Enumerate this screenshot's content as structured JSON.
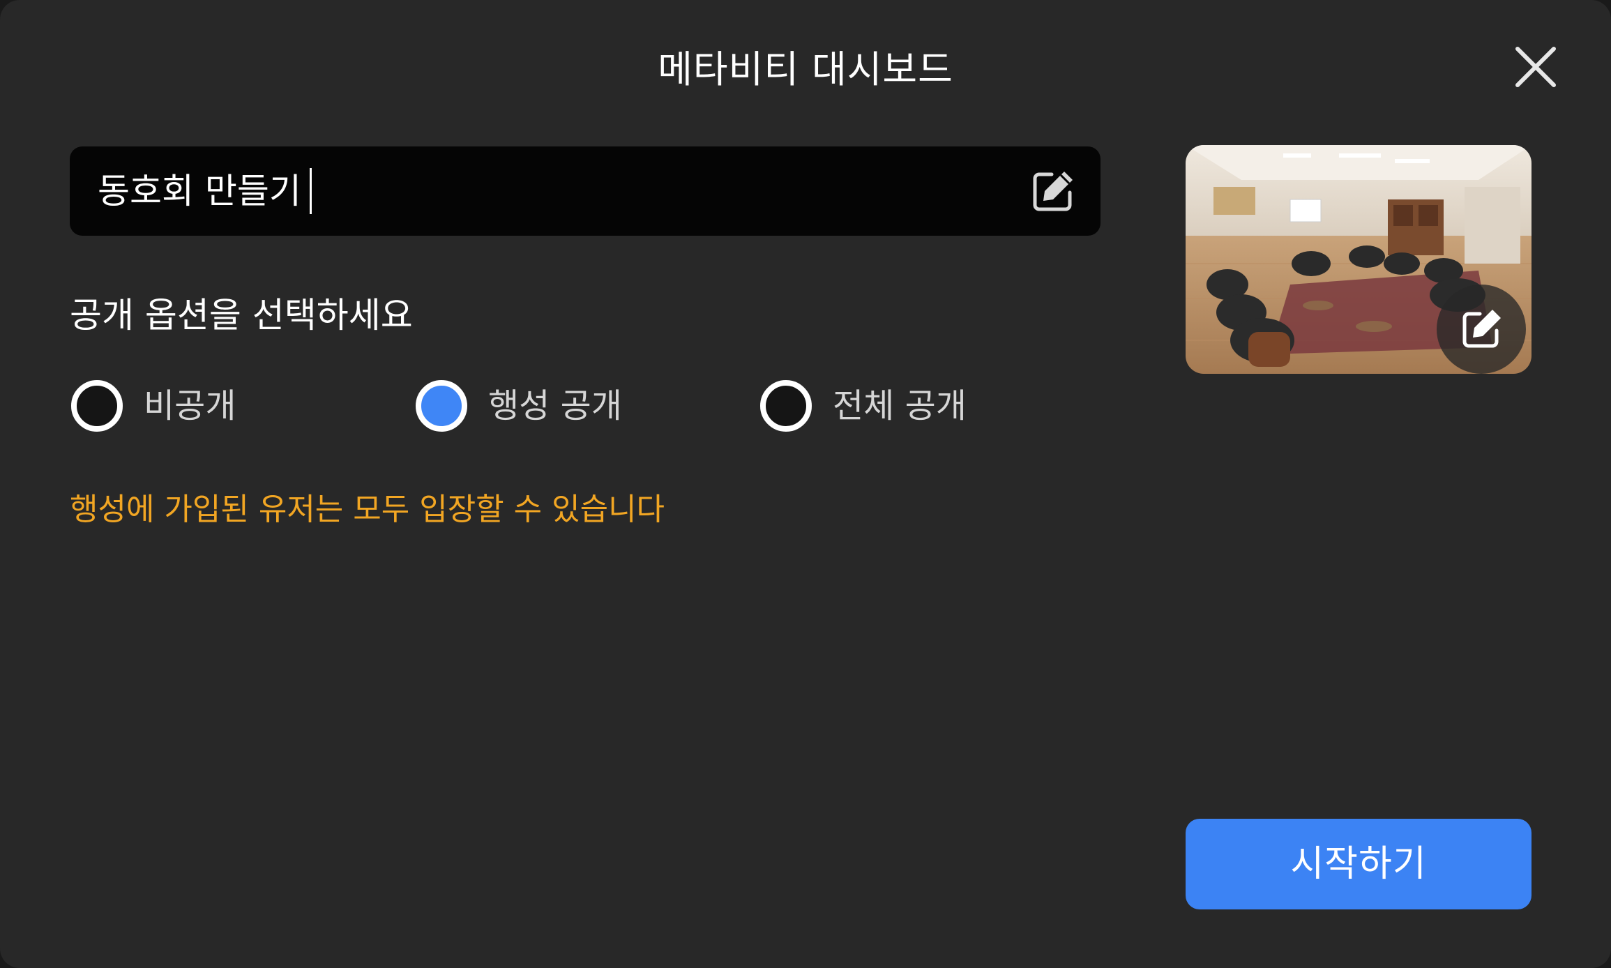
{
  "dialog": {
    "title": "메타비티 대시보드"
  },
  "name_field": {
    "value": "동호회 만들기"
  },
  "visibility": {
    "heading": "공개 옵션을 선택하세요",
    "options": [
      {
        "label": "비공개",
        "selected": false
      },
      {
        "label": "행성 공개",
        "selected": true
      },
      {
        "label": "전체 공개",
        "selected": false
      }
    ],
    "notice": "행성에 가입된 유저는 모두 입장할 수 있습니다"
  },
  "start_button": {
    "label": "시작하기"
  },
  "colors": {
    "background": "#282828",
    "input_background": "#050505",
    "accent": "#3c83f4",
    "notice": "#f2a623"
  },
  "icons": [
    "close-icon",
    "edit-icon",
    "room-thumbnail"
  ]
}
